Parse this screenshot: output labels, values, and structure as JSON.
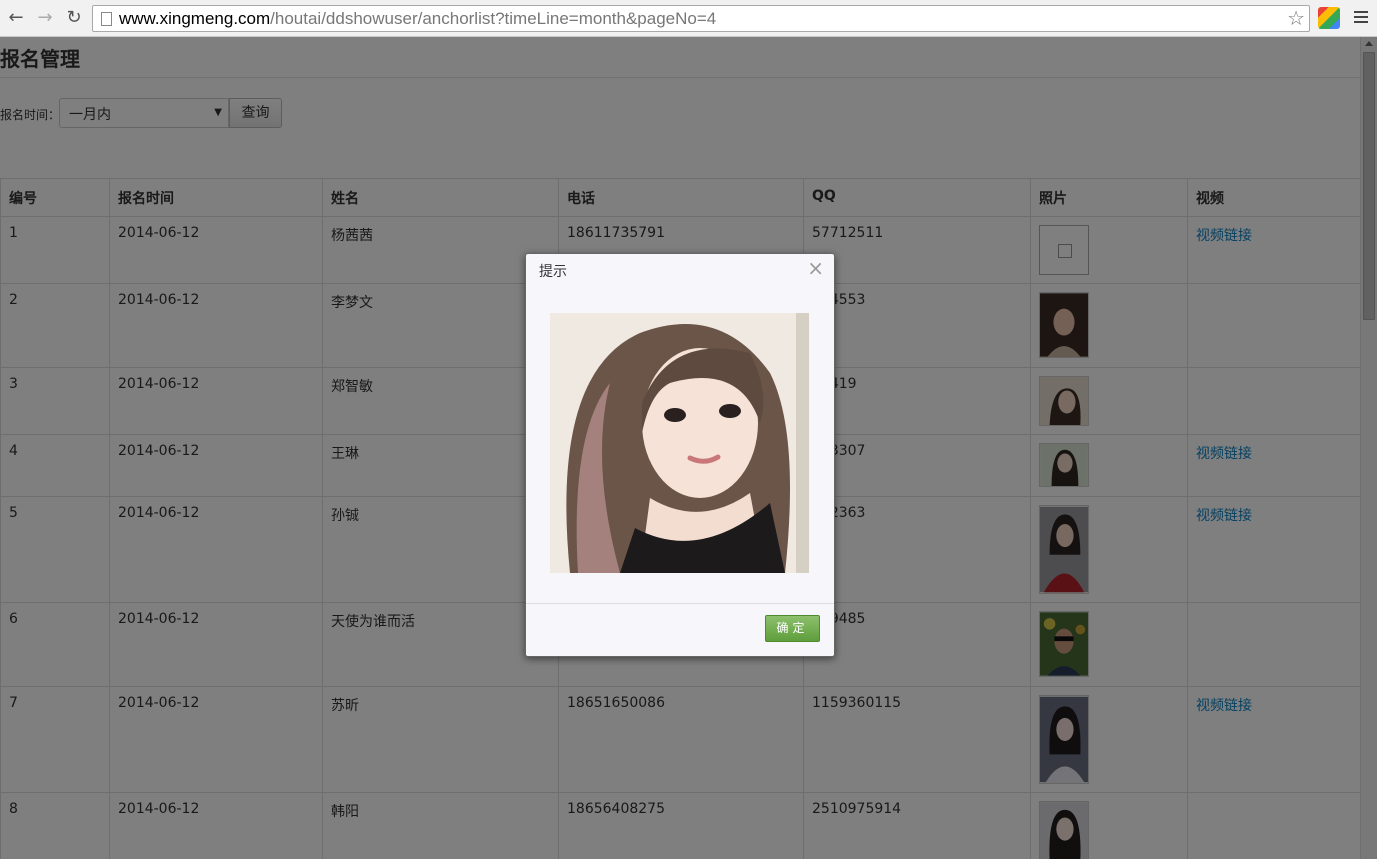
{
  "browser": {
    "url_host": "www.xingmeng.com",
    "url_path": "/houtai/ddshowuser/anchorlist?timeLine=month&pageNo=4"
  },
  "page": {
    "title": "报名管理",
    "filter_label": "报名时间：",
    "filter_value": "一月内",
    "query_label": "查询"
  },
  "table": {
    "headers": [
      "编号",
      "报名时间",
      "姓名",
      "电话",
      "QQ",
      "照片",
      "视频"
    ],
    "video_link_label": "视频链接",
    "rows": [
      {
        "id": "1",
        "date": "2014-06-12",
        "name": "杨茜茜",
        "phone": "18611735791",
        "qq": "57712511",
        "video": true
      },
      {
        "id": "2",
        "date": "2014-06-12",
        "name": "李梦文",
        "phone": "",
        "qq": "954553",
        "video": false
      },
      {
        "id": "3",
        "date": "2014-06-12",
        "name": "郑智敏",
        "phone": "",
        "qq": "45419",
        "video": false
      },
      {
        "id": "4",
        "date": "2014-06-12",
        "name": "王琳",
        "phone": "",
        "qq": "933307",
        "video": true
      },
      {
        "id": "5",
        "date": "2014-06-12",
        "name": "孙铖",
        "phone": "",
        "qq": "302363",
        "video": true
      },
      {
        "id": "6",
        "date": "2014-06-12",
        "name": "天使为谁而活",
        "phone": "",
        "qq": "909485",
        "video": false
      },
      {
        "id": "7",
        "date": "2014-06-12",
        "name": "苏昕",
        "phone": "18651650086",
        "qq": "1159360115",
        "video": true
      },
      {
        "id": "8",
        "date": "2014-06-12",
        "name": "韩阳",
        "phone": "18656408275",
        "qq": "2510975914",
        "video": false
      }
    ]
  },
  "dialog": {
    "title": "提示",
    "ok_label": "确定"
  },
  "colors": {
    "link": "#0a82c4",
    "ok_button": "#6aaa45"
  }
}
